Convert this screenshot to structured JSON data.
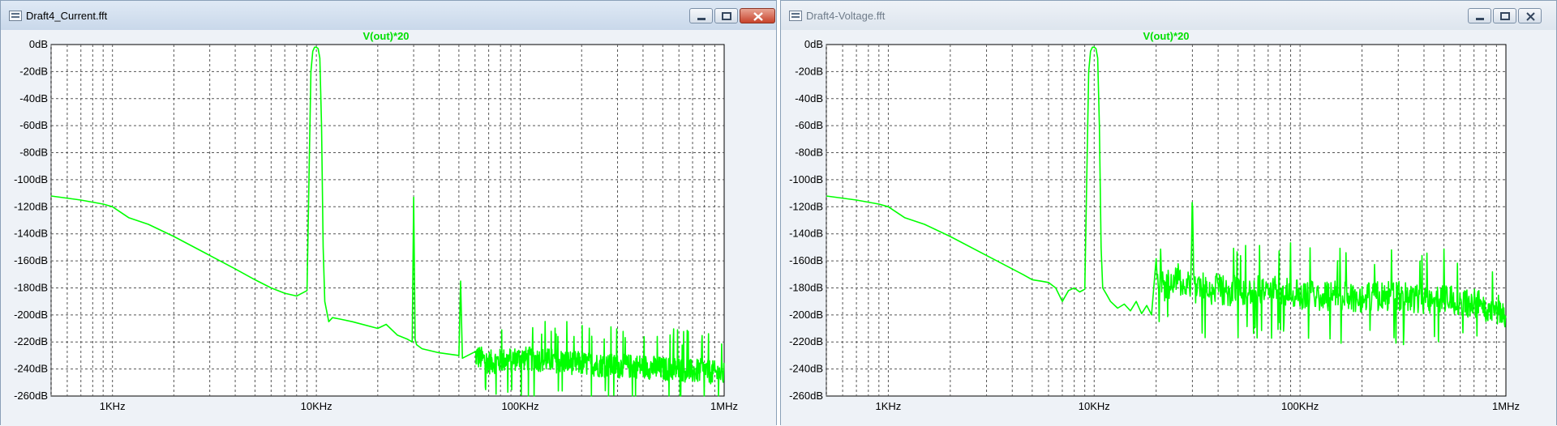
{
  "windows": [
    {
      "title": "Draft4_Current.fft",
      "trace_label": "V(out)*20"
    },
    {
      "title": "Draft4-Voltage.fft",
      "trace_label": "V(out)*20"
    }
  ],
  "colors": {
    "trace": "#00ff00",
    "grid": "#555555",
    "plot_bg": "#ffffff",
    "label": "#00e000"
  },
  "chart_data": [
    {
      "type": "line",
      "title": "V(out)*20",
      "xscale": "log",
      "xlim": [
        500,
        1000000
      ],
      "ylim": [
        -260,
        0
      ],
      "grid": true,
      "y_tick_labels": [
        "0dB",
        "-20dB",
        "-40dB",
        "-60dB",
        "-80dB",
        "-100dB",
        "-120dB",
        "-140dB",
        "-160dB",
        "-180dB",
        "-200dB",
        "-220dB",
        "-240dB",
        "-260dB"
      ],
      "x_tick_labels": [
        "1KHz",
        "10KHz",
        "100KHz",
        "1MHz"
      ],
      "series": [
        {
          "name": "V(out)*20",
          "x": [
            500,
            700,
            900,
            1000,
            1200,
            1500,
            2000,
            3000,
            4000,
            5000,
            6000,
            7000,
            8000,
            8500,
            9000,
            9200,
            9400,
            9600,
            9800,
            10000,
            10200,
            10400,
            10600,
            10800,
            11000,
            11500,
            12000,
            13000,
            15000,
            20000,
            22000,
            25000,
            28000,
            29500,
            30000,
            30500,
            31000,
            33000,
            40000,
            50000,
            51000,
            52000,
            60000,
            70000,
            100000,
            150000,
            200000,
            300000,
            400000,
            500000,
            600000,
            700000,
            800000,
            900000,
            1000000
          ],
          "y": [
            -112,
            -115,
            -118,
            -120,
            -128,
            -133,
            -142,
            -156,
            -166,
            -174,
            -180,
            -184,
            -186,
            -184,
            -182,
            -100,
            -20,
            -5,
            -2,
            -2,
            -3,
            -10,
            -60,
            -150,
            -190,
            -205,
            -202,
            -203,
            -205,
            -210,
            -207,
            -215,
            -218,
            -220,
            -113,
            -218,
            -222,
            -225,
            -228,
            -230,
            -175,
            -232,
            -230,
            -235,
            -232,
            -234,
            -236,
            -238,
            -238,
            -240,
            -240,
            -242,
            -241,
            -243,
            -244
          ],
          "noise_band_from_hz": 60000,
          "noise_band_db": [
            -250,
            -210
          ]
        }
      ]
    },
    {
      "type": "line",
      "title": "V(out)*20",
      "xscale": "log",
      "xlim": [
        500,
        1000000
      ],
      "ylim": [
        -260,
        0
      ],
      "grid": true,
      "y_tick_labels": [
        "0dB",
        "-20dB",
        "-40dB",
        "-60dB",
        "-80dB",
        "-100dB",
        "-120dB",
        "-140dB",
        "-160dB",
        "-180dB",
        "-200dB",
        "-220dB",
        "-240dB",
        "-260dB"
      ],
      "x_tick_labels": [
        "1KHz",
        "10KHz",
        "100KHz",
        "1MHz"
      ],
      "series": [
        {
          "name": "V(out)*20",
          "x": [
            500,
            700,
            900,
            1000,
            1200,
            1500,
            2000,
            3000,
            4000,
            4500,
            5000,
            5500,
            6000,
            6500,
            7000,
            7500,
            8000,
            8500,
            9000,
            9200,
            9400,
            9600,
            9800,
            10000,
            10200,
            10400,
            10600,
            10800,
            11000,
            11500,
            12000,
            13000,
            14000,
            15000,
            16000,
            17000,
            18000,
            19000,
            20000,
            22000,
            25000,
            28000,
            29500,
            30000,
            30500,
            31000,
            33000,
            36000,
            40000,
            45000,
            50000,
            55000,
            60000,
            70000,
            80000,
            100000,
            150000,
            200000,
            300000,
            400000,
            500000,
            600000,
            700000,
            800000,
            900000,
            1000000
          ],
          "y": [
            -112,
            -115,
            -118,
            -120,
            -128,
            -133,
            -142,
            -156,
            -166,
            -170,
            -174,
            -175,
            -176,
            -180,
            -190,
            -182,
            -180,
            -183,
            -181,
            -100,
            -20,
            -5,
            -2,
            -2,
            -3,
            -10,
            -60,
            -150,
            -180,
            -185,
            -190,
            -195,
            -192,
            -197,
            -190,
            -199,
            -193,
            -200,
            -168,
            -180,
            -172,
            -178,
            -175,
            -113,
            -175,
            -180,
            -178,
            -182,
            -180,
            -183,
            -180,
            -182,
            -180,
            -182,
            -183,
            -185,
            -186,
            -187,
            -186,
            -188,
            -187,
            -189,
            -192,
            -194,
            -196,
            -198
          ],
          "noise_band_from_hz": 20000,
          "noise_band_db": [
            -210,
            -160
          ]
        }
      ]
    }
  ]
}
